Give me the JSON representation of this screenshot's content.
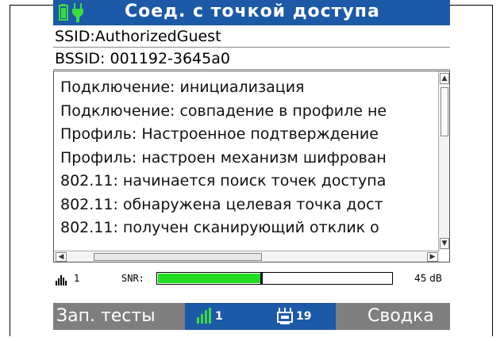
{
  "header": {
    "title": "Соед. с точкой доступа",
    "battery_icon": "battery-icon",
    "plug_icon": "plug-icon",
    "accent_color": "#1c59a6"
  },
  "info": {
    "ssid": "SSID:AuthorizedGuest",
    "bssid": "BSSID: 001192-3645a0"
  },
  "log": {
    "lines": [
      "Подключение: инициализация",
      "Подключение: совпадение в профиле не",
      "Профиль: Настроенное подтверждение",
      "Профиль: настроен механизм шифрован",
      "802.11: начинается поиск точек доступа",
      "802.11: обнаружена целевая точка дост",
      "802.11: получен сканирующий отклик о"
    ]
  },
  "snr": {
    "signal_icon": "signal-bars-icon",
    "channel": "1",
    "label": "SNR:",
    "value": "45 dB",
    "fill_percent": 44,
    "fill_color": "#22dd22"
  },
  "tabs": {
    "tests_label": "Зап. тесты",
    "networks_icon": "signal-bars-icon",
    "networks_count": "1",
    "devices_icon": "network-devices-icon",
    "devices_count": "19",
    "summary_label": "Сводка"
  }
}
